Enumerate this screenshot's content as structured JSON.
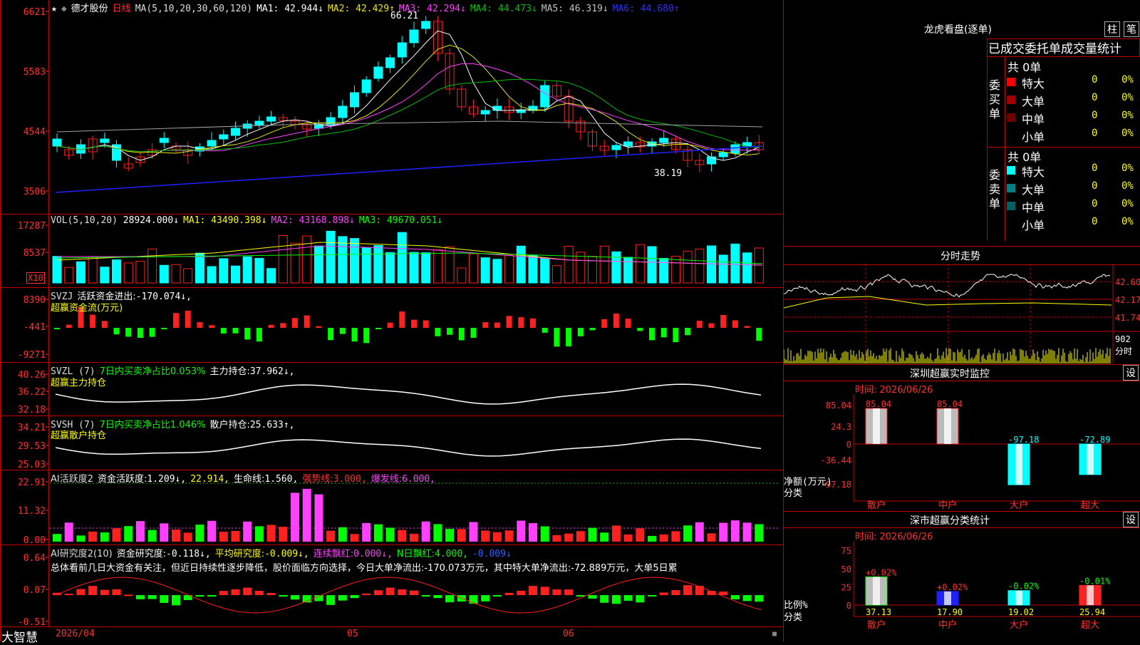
{
  "window": {
    "title": "德才股份",
    "period": "日线",
    "logo": "大智慧"
  },
  "colors": {
    "up": "#ff2020",
    "down": "#00ffff",
    "frame": "#c00000",
    "ma1": "#ffffff",
    "ma2": "#e8e800",
    "ma3": "#ff40ff",
    "ma4": "#00c000",
    "ma5": "#a0a0a0",
    "ma6": "#2020ff"
  },
  "price_panel": {
    "ma_label": "MA(5,10,20,30,60,120)",
    "ma_values": [
      {
        "name": "MA1:",
        "value": "42.944↓",
        "color": "#ffffff"
      },
      {
        "name": "MA2:",
        "value": "42.429↑",
        "color": "#e8e800"
      },
      {
        "name": "MA3:",
        "value": "42.294↓",
        "color": "#ff40ff"
      },
      {
        "name": "MA4:",
        "value": "44.473↓",
        "color": "#00c000"
      },
      {
        "name": "MA5:",
        "value": "46.319↓",
        "color": "#c0c0c0"
      },
      {
        "name": "MA6:",
        "value": "44.680↑",
        "color": "#3030ff"
      }
    ],
    "y_ticks": [
      "6621",
      "5583",
      "4544",
      "3506"
    ],
    "high_label": "66.21",
    "low_label": "38.19"
  },
  "vol_panel": {
    "label": "VOL(5,10,20)",
    "value": "28924.000↓",
    "ma_values": [
      {
        "name": "MA1:",
        "value": "43490.398↓",
        "color": "#ffff00"
      },
      {
        "name": "MA2:",
        "value": "43168.898↓",
        "color": "#ff40ff"
      },
      {
        "name": "MA3:",
        "value": "49670.051↓",
        "color": "#00ff00"
      }
    ],
    "y_ticks": [
      "17287",
      "8537"
    ],
    "unit": "X10"
  },
  "svzj_panel": {
    "label": "SVZJ",
    "desc": "活跃资金进出:",
    "value": "-170.074↓,",
    "sub": "超赢资金流(万元)",
    "y_ticks": [
      "8390",
      "-441",
      "-9271"
    ]
  },
  "svzl_panel": {
    "label": "SVZL (7)",
    "desc": "7日内买卖净占比0.053%",
    "desc2": "主力持仓:",
    "value": "37.962↓,",
    "sub": "超赢主力持仓",
    "y_ticks": [
      "40.26",
      "36.22",
      "32.18"
    ]
  },
  "svsh_panel": {
    "label": "SVSH (7)",
    "desc": "7日内买卖净占比1.046%",
    "desc2": "散户持仓:",
    "value": "25.633↑,",
    "sub": "超赢散户持仓",
    "y_ticks": [
      "34.21",
      "29.53",
      "25.03"
    ]
  },
  "ai_panel": {
    "label": "AI活跃度2",
    "desc": "资金活跃度:",
    "value": "1.209↓,",
    "v2": "22.914,",
    "desc3": "生命线:",
    "v3": "1.560,",
    "desc4": "强势线:",
    "v4": "3.000,",
    "desc5": "爆发线:",
    "v5": "6.000,",
    "y_ticks": [
      "22.91",
      "11.32",
      "0.00"
    ]
  },
  "research_panel": {
    "label": "AI研究度2(10)",
    "desc": "资金研究度:",
    "value": "-0.118↓,",
    "d2": "平均研究度:",
    "v2": "-0.009↓,",
    "d3": "连续飘红:",
    "v3": "0.000↓,",
    "d4": "N日飘红:",
    "v4": "4.000,",
    "v5": "-0.009↓",
    "text": "总体看前几日大资金有关注，但近日持续性逐步降低，股价面临方向选择，今日大单净流出:-170.073万元，其中特大单净流出:-72.889万元，大单5日累",
    "y_ticks": [
      "0.64",
      "0.07",
      "-0.51"
    ]
  },
  "x_axis": {
    "date": "2026/04",
    "m5": "05",
    "m6": "06"
  },
  "dragon": {
    "title": "龙虎看盘(逐单)",
    "btn1": "柱",
    "btn2": "笔",
    "header": "已成交委托单成交量统计",
    "buy": {
      "side": "委买单",
      "total": "共 0单",
      "rows": [
        {
          "name": "特大",
          "count": "0",
          "pct": "0%",
          "color": "#ff0000"
        },
        {
          "name": "大单",
          "count": "0",
          "pct": "0%",
          "color": "#a00000"
        },
        {
          "name": "中单",
          "count": "0",
          "pct": "0%",
          "color": "#700000"
        },
        {
          "name": "小单",
          "count": "0",
          "pct": "0%",
          "color": "#000000"
        }
      ]
    },
    "sell": {
      "side": "委卖单",
      "total": "共 0单",
      "rows": [
        {
          "name": "特大",
          "count": "0",
          "pct": "0%",
          "color": "#00ffff"
        },
        {
          "name": "大单",
          "count": "0",
          "pct": "0%",
          "color": "#008080"
        },
        {
          "name": "中单",
          "count": "0",
          "pct": "0%",
          "color": "#006060"
        },
        {
          "name": "小单",
          "count": "0",
          "pct": "0%",
          "color": "#000000"
        }
      ]
    }
  },
  "intraday": {
    "title": "分时走势",
    "y_ticks": [
      "42.60",
      "42.17",
      "41.74"
    ],
    "vol_tick": "902",
    "unit": "分时"
  },
  "monitor": {
    "title": "深圳超赢实时监控",
    "btn": "设",
    "time": "时间: 2026/06/26",
    "y_ticks": [
      "85.04",
      "24.3",
      "0",
      "-36.44",
      "-97.18"
    ],
    "axis_label": "净额(万元)",
    "cat_label": "分类",
    "bars": [
      {
        "cat": "散户",
        "value": 85.04,
        "label": "85.04"
      },
      {
        "cat": "中户",
        "value": 85.04,
        "label": "85.04"
      },
      {
        "cat": "大户",
        "value": -97.18,
        "label": "-97.18"
      },
      {
        "cat": "超大",
        "value": -72.89,
        "label": "-72.89"
      }
    ]
  },
  "classify": {
    "title": "深市超赢分类统计",
    "btn": "设",
    "time": "时间: 2026/06/26",
    "y_ticks": [
      "75",
      "50",
      "25",
      "0"
    ],
    "axis_label": "比例%",
    "cat_label": "分类",
    "bars": [
      {
        "cat": "散户",
        "value": 37.13,
        "label": "37.13",
        "chg": "+0.02%"
      },
      {
        "cat": "中户",
        "value": 17.9,
        "label": "17.90",
        "chg": "+0.02%"
      },
      {
        "cat": "大户",
        "value": 19.02,
        "label": "19.02",
        "chg": "-0.02%"
      },
      {
        "cat": "超大",
        "value": 25.94,
        "label": "25.94",
        "chg": "-0.01%"
      }
    ]
  }
}
